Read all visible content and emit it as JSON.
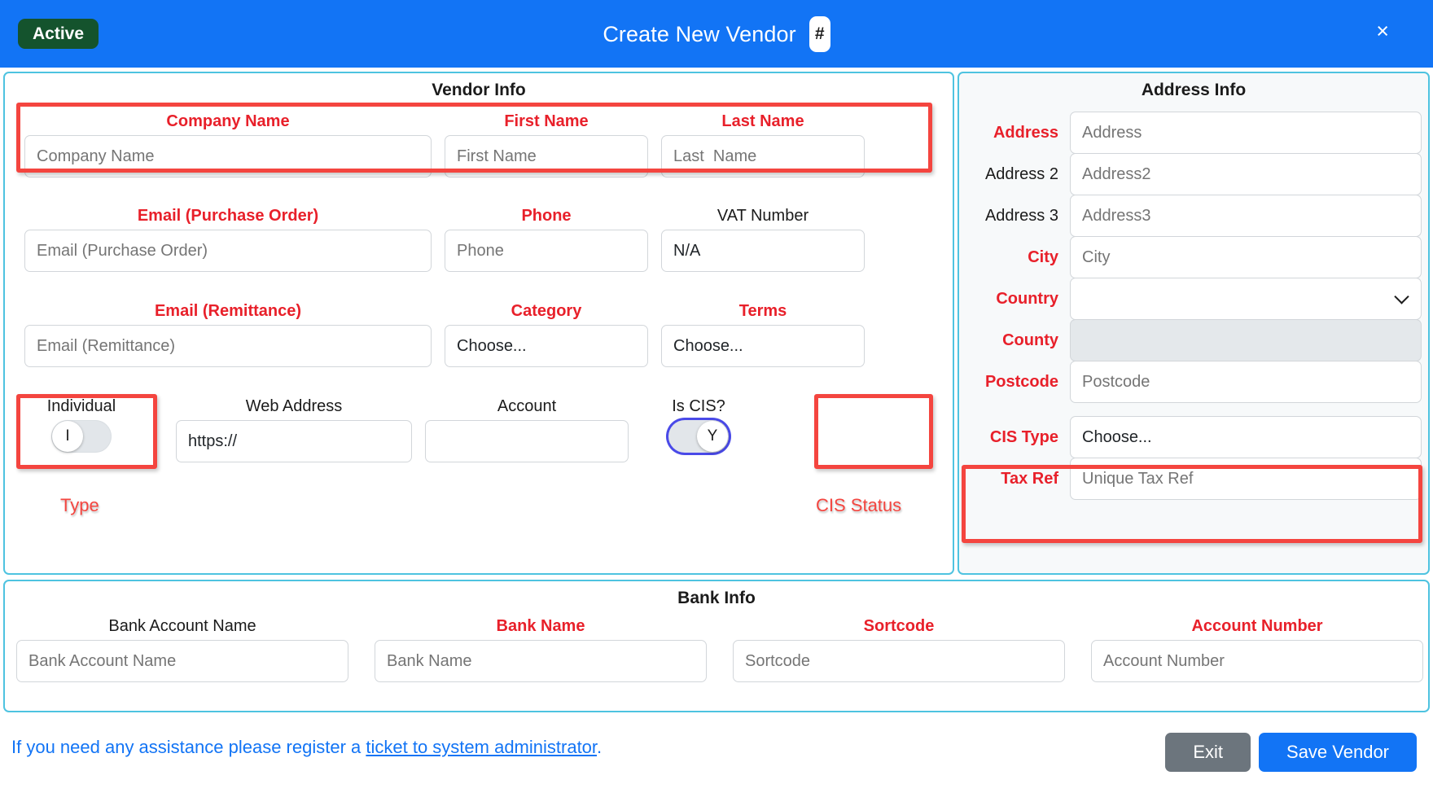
{
  "titlebar": {
    "status_badge": "Active",
    "title": "Create New Vendor",
    "hash_badge": "#",
    "close_label": "×",
    "bg_color": "#1274f5",
    "badge_color": "#14532d"
  },
  "vendor_panel": {
    "title": "Vendor Info",
    "fields": {
      "company_name": {
        "label": "Company Name",
        "placeholder": "Company Name",
        "value": "",
        "required": true
      },
      "first_name": {
        "label": "First Name",
        "placeholder": "First Name",
        "value": "",
        "required": true
      },
      "last_name": {
        "label": "Last Name",
        "placeholder": "Last  Name",
        "value": "",
        "required": true
      },
      "email_po": {
        "label": "Email (Purchase Order)",
        "placeholder": "Email (Purchase Order)",
        "value": "",
        "required": true
      },
      "phone": {
        "label": "Phone",
        "placeholder": "Phone",
        "value": "",
        "required": true
      },
      "vat_number": {
        "label": "VAT Number",
        "placeholder": "VAT Number",
        "value": "N/A",
        "required": false
      },
      "email_rem": {
        "label": "Email (Remittance)",
        "placeholder": "Email (Remittance)",
        "value": "",
        "required": true
      },
      "category": {
        "label": "Category",
        "placeholder": "Choose...",
        "value": "Choose...",
        "required": true
      },
      "terms": {
        "label": "Terms",
        "placeholder": "Choose...",
        "value": "Choose...",
        "required": true
      },
      "individual": {
        "label": "Individual",
        "toggle_state": "I",
        "toggle_on": false,
        "required": false
      },
      "web_address": {
        "label": "Web Address",
        "placeholder": "https://",
        "value": "https://",
        "required": false
      },
      "account": {
        "label": "Account",
        "placeholder": "",
        "value": "",
        "required": false
      },
      "is_cis": {
        "label": "Is CIS?",
        "toggle_state": "Y",
        "toggle_on": true,
        "required": false
      }
    },
    "annotations": {
      "type_label": "Type",
      "cis_status_label": "CIS Status"
    }
  },
  "address_panel": {
    "title": "Address Info",
    "rows": [
      {
        "label": "Address",
        "placeholder": "Address",
        "value": "",
        "required": true,
        "kind": "text"
      },
      {
        "label": "Address 2",
        "placeholder": "Address2",
        "value": "",
        "required": false,
        "kind": "text"
      },
      {
        "label": "Address 3",
        "placeholder": "Address3",
        "value": "",
        "required": false,
        "kind": "text"
      },
      {
        "label": "City",
        "placeholder": "City",
        "value": "",
        "required": true,
        "kind": "text"
      },
      {
        "label": "Country",
        "placeholder": "",
        "value": "",
        "required": true,
        "kind": "select"
      },
      {
        "label": "County",
        "placeholder": "",
        "value": "",
        "required": true,
        "kind": "disabled"
      },
      {
        "label": "Postcode",
        "placeholder": "Postcode",
        "value": "",
        "required": true,
        "kind": "text"
      },
      {
        "label": "CIS Type",
        "placeholder": "Choose...",
        "value": "Choose...",
        "required": true,
        "kind": "select-plain"
      },
      {
        "label": "Tax Ref",
        "placeholder": "Unique Tax Ref",
        "value": "",
        "required": true,
        "kind": "text"
      }
    ]
  },
  "bank_panel": {
    "title": "Bank Info",
    "fields": [
      {
        "label": "Bank Account Name",
        "placeholder": "Bank Account Name",
        "value": "",
        "required": false
      },
      {
        "label": "Bank Name",
        "placeholder": "Bank Name",
        "value": "",
        "required": true
      },
      {
        "label": "Sortcode",
        "placeholder": "Sortcode",
        "value": "",
        "required": true
      },
      {
        "label": "Account Number",
        "placeholder": "Account Number",
        "value": "",
        "required": true
      }
    ]
  },
  "footer": {
    "note_prefix": "If you need any assistance please register a ",
    "note_link": "ticket to system administrator",
    "note_suffix": ".",
    "exit_label": "Exit",
    "save_label": "Save Vendor",
    "link_color": "#1274f5",
    "save_color": "#1274f5",
    "exit_color": "#6c757d"
  },
  "colors": {
    "required_red": "#e8202a",
    "annotation_red": "#f4453f",
    "panel_border": "#4ec3e0"
  }
}
